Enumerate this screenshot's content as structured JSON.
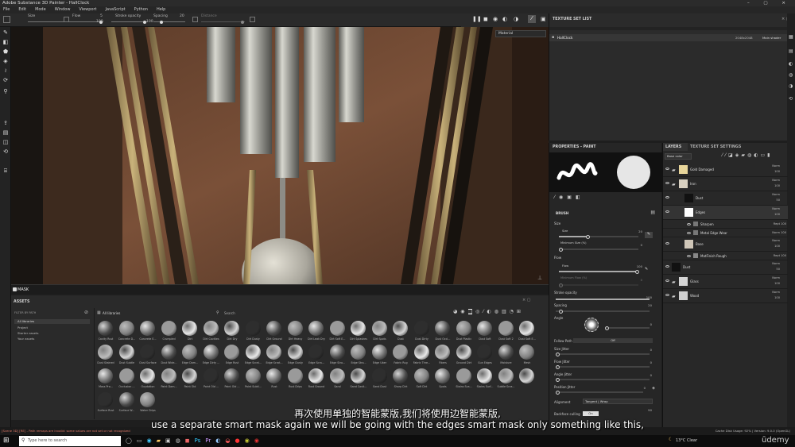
{
  "window": {
    "title": "Adobe Substance 3D Painter - HallClock",
    "controls": "– ▢ ×"
  },
  "menu": [
    "File",
    "Edit",
    "Mode",
    "Window",
    "Viewport",
    "JavaScript",
    "Python",
    "Help"
  ],
  "tool_options": {
    "size_label": "Size",
    "size_value": "5",
    "flow_label": "Flow",
    "flow_value": "100",
    "stroke_opacity_label": "Stroke opacity",
    "stroke_opacity_value": "100",
    "spacing_label": "Spacing",
    "spacing_value": "20",
    "distance_label": "Distance"
  },
  "viewport": {
    "material_dropdown": "Material"
  },
  "mask_bar": {
    "label": "MASK"
  },
  "assets": {
    "title": "ASSETS",
    "filter_label": "FILTER BY PATH",
    "breadcrumb": "All libraries",
    "search_placeholder": "Search",
    "tree": [
      "All libraries",
      "Project",
      "Starter assets",
      "Your assets"
    ],
    "items": [
      "Cavity Rust",
      "Concrete D...",
      "Concrete E...",
      "Crumpled",
      "Dirt",
      "Dirt Cavities",
      "Dirt Dry",
      "Dirt Dusty",
      "Dirt Ground",
      "Dirt Heavy",
      "Dirt Leak Dry",
      "Dirt Soft E...",
      "Dirt Splashes",
      "Dirt Spots",
      "Dust",
      "Dust Dirty",
      "Dust Occl...",
      "Dust Plastic",
      "Dust Soft",
      "Dust Soft 2",
      "Dust Soft E...",
      "Dust Stained",
      "Dust Subtle",
      "Dust Surface",
      "Dust Wide...",
      "Edge Dam...",
      "Edge Dirty ...",
      "Edge Rust",
      "Edge Scrat...",
      "Edge Scrat...",
      "Edge Dusty",
      "Edge Scra...",
      "Edge Stro...",
      "Edge Stro...",
      "Edge Uber",
      "Fabric Rug",
      "Fabric Thre...",
      "Fibers",
      "Ground Dirt",
      "Gun Edges",
      "Moisture",
      "Mesh",
      "Moss Pro...",
      "Occlusion ...",
      "Oxydation",
      "Paint Dam...",
      "Paint Old",
      "Paint Old ...",
      "Paint Old ...",
      "Paint Subtl...",
      "Rust",
      "Rust Drips",
      "Rust Ground",
      "Sand",
      "Sand Cavit...",
      "Sand Dust",
      "Sharp Dirt",
      "Soft Dirt",
      "Spots",
      "Stains Sca...",
      "Stains Surf...",
      "Subtle Scra...",
      "",
      "Surface Rust",
      "Surface W...",
      "Water Drips"
    ]
  },
  "texture_set_list": {
    "title": "TEXTURE SET LIST",
    "row_name": "HallClock",
    "row_size": "2048x2048",
    "row_shader": "Main shader"
  },
  "properties": {
    "title": "PROPERTIES - PAINT",
    "brush_header": "BRUSH",
    "size_label": "Size",
    "size_value": "20",
    "min_size_label": "Minimum Size (%)",
    "min_size_value": "0",
    "flow_label": "Flow",
    "flow_sub": "Flow",
    "flow_value": "100",
    "min_flow_label": "Minimum Flow (%)",
    "min_flow_value": "0",
    "stroke_opacity_label": "Stroke opacity",
    "stroke_opacity_value": "100",
    "spacing_label": "Spacing",
    "spacing_value": "20",
    "angle_label": "Angle",
    "angle_value": "0",
    "follow_path_label": "Follow Path",
    "follow_path_value": "Off",
    "size_jitter_label": "Size Jitter",
    "size_jitter_value": "0",
    "flow_jitter_label": "Flow Jitter",
    "flow_jitter_value": "0",
    "angle_jitter_label": "Angle Jitter",
    "angle_jitter_value": "0",
    "position_jitter_label": "Position Jitter",
    "position_jitter_value": "0",
    "alignment_label": "Alignment",
    "alignment_value": "Tangent | Wrap",
    "backface_label": "Backface culling",
    "backface_value": "On",
    "last_value": "90"
  },
  "layers": {
    "tab_layers": "LAYERS",
    "tab_texture_set_settings": "TEXTURE SET SETTINGS",
    "channel_dropdown": "Base color",
    "rows": [
      {
        "name": "Gold Damaged",
        "blend": "Norm",
        "opacity": "100"
      },
      {
        "name": "Iron",
        "blend": "Norm",
        "opacity": "100"
      },
      {
        "name": "Dust",
        "blend": "Norm",
        "opacity": "50"
      },
      {
        "name": "Edges",
        "blend": "Norm",
        "opacity": "100"
      },
      {
        "name": "Sharpen",
        "blend": "Rept",
        "opacity": "100"
      },
      {
        "name": "Metal Edge Wear",
        "blend": "Norm",
        "opacity": "100"
      },
      {
        "name": "Base",
        "blend": "Norm",
        "opacity": "100"
      },
      {
        "name": "MatFinish Rough",
        "blend": "Rept",
        "opacity": "100"
      },
      {
        "name": "Dust",
        "blend": "Norm",
        "opacity": "50"
      },
      {
        "name": "Glass",
        "blend": "Norm",
        "opacity": "100"
      },
      {
        "name": "Wood",
        "blend": "Norm",
        "opacity": "100"
      }
    ]
  },
  "status": {
    "left": "[Scene 3D] [RE] - Path remaps are invalid: some values are not set or not recognized",
    "right": "Cache Disk Usage:  92% | Version: 9.0.0 (OpenGL)"
  },
  "subtitles": {
    "chinese": "再次使用单独的智能蒙版,我们将使用边智能蒙版,",
    "english": "use a separate smart mask again we will be going with the edges smart mask only something like this,"
  },
  "taskbar": {
    "search_placeholder": "Type here to search",
    "weather": "13°C  Clear",
    "brand": "ūdemy"
  }
}
